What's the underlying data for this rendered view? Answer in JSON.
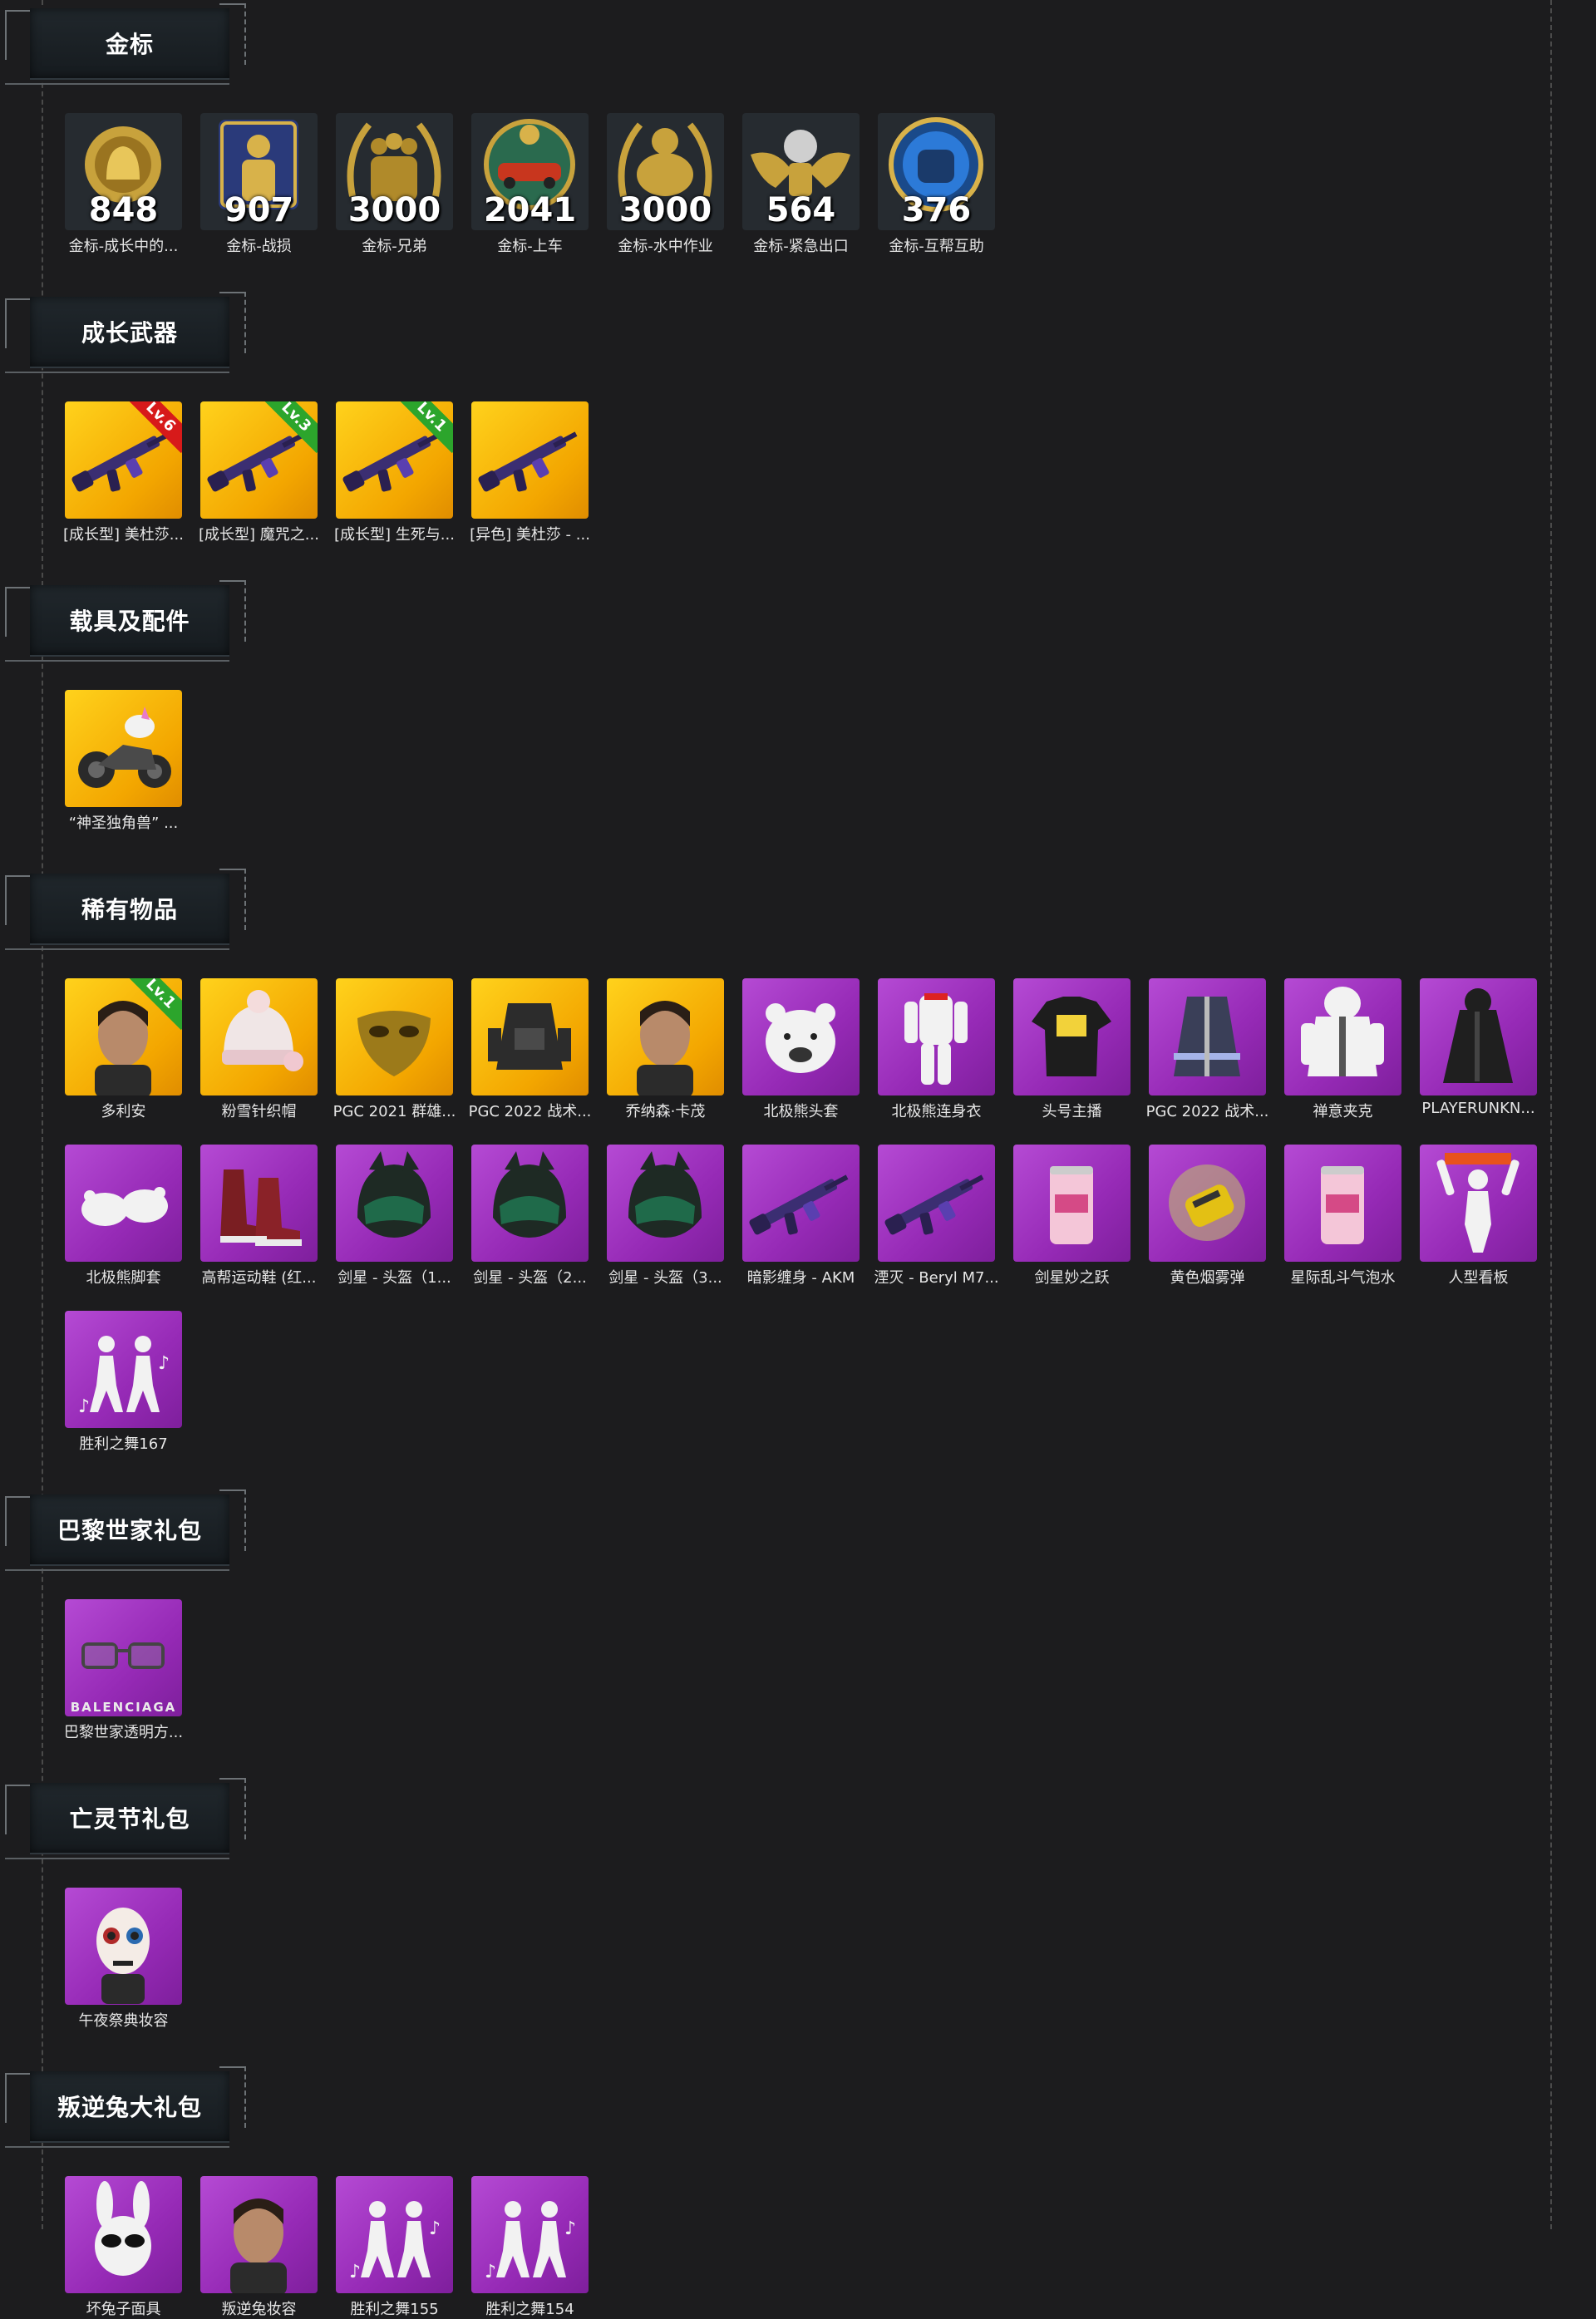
{
  "sections": [
    {
      "title": "金标",
      "items": [
        {
          "label": "金标-成长中的...",
          "count": "848",
          "bg": "medal",
          "icon": "bell-medal-icon"
        },
        {
          "label": "金标-战损",
          "count": "907",
          "bg": "medal",
          "icon": "soldier-medal-icon"
        },
        {
          "label": "金标-兄弟",
          "count": "3000",
          "bg": "medal",
          "icon": "brothers-medal-icon"
        },
        {
          "label": "金标-上车",
          "count": "2041",
          "bg": "medal",
          "icon": "car-medal-icon"
        },
        {
          "label": "金标-水中作业",
          "count": "3000",
          "bg": "medal",
          "icon": "seal-medal-icon"
        },
        {
          "label": "金标-紧急出口",
          "count": "564",
          "bg": "medal",
          "icon": "winged-medal-icon"
        },
        {
          "label": "金标-互帮互助",
          "count": "376",
          "bg": "medal",
          "icon": "helmet-medal-icon"
        }
      ]
    },
    {
      "title": "成长武器",
      "items": [
        {
          "label": "[成长型] 美杜莎...",
          "bg": "gold",
          "icon": "rifle-icon",
          "lv": "Lv.6",
          "lv_color": "red"
        },
        {
          "label": "[成长型] 魔咒之...",
          "bg": "gold",
          "icon": "rifle-icon",
          "lv": "Lv.3",
          "lv_color": "green"
        },
        {
          "label": "[成长型] 生死与...",
          "bg": "gold",
          "icon": "rifle-icon",
          "lv": "Lv.1",
          "lv_color": "green"
        },
        {
          "label": "[异色] 美杜莎 - ...",
          "bg": "gold",
          "icon": "rifle-icon"
        }
      ]
    },
    {
      "title": "载具及配件",
      "items": [
        {
          "label": "“神圣独角兽” ...",
          "bg": "gold",
          "icon": "motorcycle-icon"
        }
      ]
    },
    {
      "title": "稀有物品",
      "items": [
        {
          "label": "多利安",
          "bg": "gold",
          "icon": "character-face-icon",
          "lv": "Lv.1",
          "lv_color": "green"
        },
        {
          "label": "粉雪针织帽",
          "bg": "gold",
          "icon": "knit-hat-icon"
        },
        {
          "label": "PGC 2021 群雄...",
          "bg": "gold",
          "icon": "mask-icon"
        },
        {
          "label": "PGC 2022 战术...",
          "bg": "gold",
          "icon": "vest-icon"
        },
        {
          "label": "乔纳森·卡茂",
          "bg": "gold",
          "icon": "character-face-icon"
        },
        {
          "label": "北极熊头套",
          "bg": "purple",
          "icon": "bear-head-icon"
        },
        {
          "label": "北极熊连身衣",
          "bg": "purple",
          "icon": "bear-suit-icon"
        },
        {
          "label": "头号主播",
          "bg": "purple",
          "icon": "tshirt-icon"
        },
        {
          "label": "PGC 2022 战术...",
          "bg": "purple",
          "icon": "coat-icon"
        },
        {
          "label": "禅意夹克",
          "bg": "purple",
          "icon": "jacket-icon"
        },
        {
          "label": "PLAYERUNKN...",
          "bg": "purple",
          "icon": "trenchcoat-icon"
        },
        {
          "label": "北极熊脚套",
          "bg": "purple",
          "icon": "bear-feet-icon"
        },
        {
          "label": "高帮运动鞋 (红...",
          "bg": "purple",
          "icon": "boots-icon"
        },
        {
          "label": "剑星 - 头盔（1...",
          "bg": "purple",
          "icon": "helmet-icon"
        },
        {
          "label": "剑星 - 头盔（2...",
          "bg": "purple",
          "icon": "helmet-icon"
        },
        {
          "label": "剑星 - 头盔（3...",
          "bg": "purple",
          "icon": "helmet-icon"
        },
        {
          "label": "暗影缠身 - AKM",
          "bg": "purple",
          "icon": "rifle-icon"
        },
        {
          "label": "湮灭 - Beryl M7...",
          "bg": "purple",
          "icon": "rifle-icon"
        },
        {
          "label": "剑星妙之跃",
          "bg": "purple",
          "icon": "soda-can-icon"
        },
        {
          "label": "黄色烟雾弹",
          "bg": "purple",
          "icon": "smoke-grenade-icon"
        },
        {
          "label": "星际乱斗气泡水",
          "bg": "purple",
          "icon": "soda-can-icon"
        },
        {
          "label": "人型看板",
          "bg": "purple",
          "icon": "figure-sign-icon"
        },
        {
          "label": "胜利之舞167",
          "bg": "purple",
          "icon": "dance-emote-icon"
        }
      ]
    },
    {
      "title": "巴黎世家礼包",
      "items": [
        {
          "label": "巴黎世家透明方...",
          "bg": "purple",
          "icon": "sunglasses-icon",
          "brand": "BALENCIAGA"
        }
      ]
    },
    {
      "title": "亡灵节礼包",
      "items": [
        {
          "label": "午夜祭典妆容",
          "bg": "purple",
          "icon": "skull-makeup-icon"
        }
      ]
    },
    {
      "title": "叛逆兔大礼包",
      "items": [
        {
          "label": "坏兔子面具",
          "bg": "purple",
          "icon": "rabbit-mask-icon"
        },
        {
          "label": "叛逆兔妆容",
          "bg": "purple",
          "icon": "character-face-icon"
        },
        {
          "label": "胜利之舞155",
          "bg": "purple",
          "icon": "dance-emote-icon"
        },
        {
          "label": "胜利之舞154",
          "bg": "purple",
          "icon": "dance-emote-icon"
        }
      ]
    }
  ]
}
